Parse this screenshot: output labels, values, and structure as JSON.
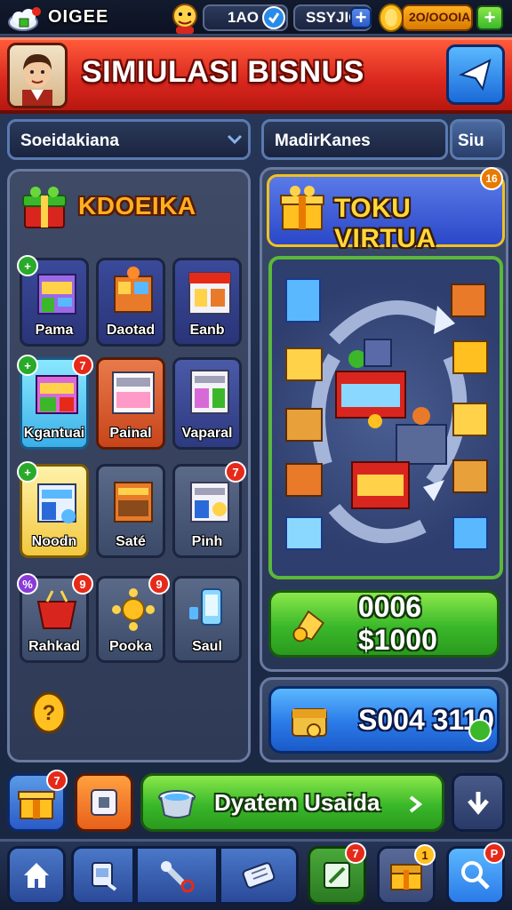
{
  "status_bar": {
    "app_name": "OIGEE",
    "stat_1": "1AO",
    "stat_2": "SSYJIO",
    "stat_3": "2O/OOOIA",
    "add_symbol": "+"
  },
  "header": {
    "title": "SIMIULASI BISNUS"
  },
  "selects": {
    "left_value": "Soeidakiana",
    "right_value": "MadirKanes",
    "right_button": "Siu"
  },
  "left_panel": {
    "title": "KDOEIKA",
    "tiles": [
      {
        "label": "Pama",
        "badge": "",
        "badge_color": "green"
      },
      {
        "label": "Daotad",
        "badge": "",
        "badge_color": ""
      },
      {
        "label": "Eanb",
        "badge": "",
        "badge_color": ""
      },
      {
        "label": "Kgantuai",
        "badge": "7",
        "badge_color": "red"
      },
      {
        "label": "Painal",
        "badge": "",
        "badge_color": ""
      },
      {
        "label": "Vaparal",
        "badge": "",
        "badge_color": ""
      },
      {
        "label": "Noodn",
        "badge": "",
        "badge_color": "green"
      },
      {
        "label": "Saté",
        "badge": "",
        "badge_color": ""
      },
      {
        "label": "Pinh",
        "badge": "7",
        "badge_color": "red"
      },
      {
        "label": "Rahkad",
        "badge": "9",
        "badge_color": "red"
      },
      {
        "label": "Pooka",
        "badge": "9",
        "badge_color": "red"
      },
      {
        "label": "Saul",
        "badge": "",
        "badge_color": ""
      }
    ]
  },
  "right_panel": {
    "banner_title": "TOKU VIRTUA",
    "banner_badge": "16",
    "green_button_value": "0006 $1000",
    "blue_button_value": "S004 3110"
  },
  "bottom_row": {
    "main_button": "Dyatem Usaida",
    "gift_badge": "7"
  },
  "nav": {
    "notif_badge_1": "7",
    "notif_badge_2": "1",
    "notif_badge_3": "P"
  },
  "colors": {
    "header_red": "#d8261e",
    "accent_gold": "#ffb020",
    "green_button": "#3ab82a",
    "blue_button": "#2a7ae8"
  }
}
